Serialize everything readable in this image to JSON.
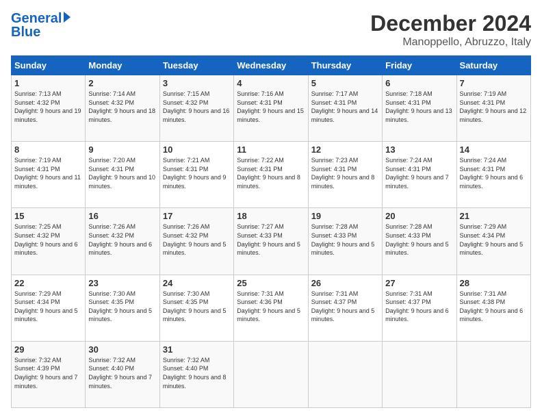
{
  "header": {
    "logo_line1": "General",
    "logo_line2": "Blue",
    "title": "December 2024",
    "subtitle": "Manoppello, Abruzzo, Italy"
  },
  "weekdays": [
    "Sunday",
    "Monday",
    "Tuesday",
    "Wednesday",
    "Thursday",
    "Friday",
    "Saturday"
  ],
  "weeks": [
    [
      {
        "day": "1",
        "sunrise": "7:13 AM",
        "sunset": "4:32 PM",
        "daylight": "9 hours and 19 minutes."
      },
      {
        "day": "2",
        "sunrise": "7:14 AM",
        "sunset": "4:32 PM",
        "daylight": "9 hours and 18 minutes."
      },
      {
        "day": "3",
        "sunrise": "7:15 AM",
        "sunset": "4:32 PM",
        "daylight": "9 hours and 16 minutes."
      },
      {
        "day": "4",
        "sunrise": "7:16 AM",
        "sunset": "4:31 PM",
        "daylight": "9 hours and 15 minutes."
      },
      {
        "day": "5",
        "sunrise": "7:17 AM",
        "sunset": "4:31 PM",
        "daylight": "9 hours and 14 minutes."
      },
      {
        "day": "6",
        "sunrise": "7:18 AM",
        "sunset": "4:31 PM",
        "daylight": "9 hours and 13 minutes."
      },
      {
        "day": "7",
        "sunrise": "7:19 AM",
        "sunset": "4:31 PM",
        "daylight": "9 hours and 12 minutes."
      }
    ],
    [
      {
        "day": "8",
        "sunrise": "7:19 AM",
        "sunset": "4:31 PM",
        "daylight": "9 hours and 11 minutes."
      },
      {
        "day": "9",
        "sunrise": "7:20 AM",
        "sunset": "4:31 PM",
        "daylight": "9 hours and 10 minutes."
      },
      {
        "day": "10",
        "sunrise": "7:21 AM",
        "sunset": "4:31 PM",
        "daylight": "9 hours and 9 minutes."
      },
      {
        "day": "11",
        "sunrise": "7:22 AM",
        "sunset": "4:31 PM",
        "daylight": "9 hours and 8 minutes."
      },
      {
        "day": "12",
        "sunrise": "7:23 AM",
        "sunset": "4:31 PM",
        "daylight": "9 hours and 8 minutes."
      },
      {
        "day": "13",
        "sunrise": "7:24 AM",
        "sunset": "4:31 PM",
        "daylight": "9 hours and 7 minutes."
      },
      {
        "day": "14",
        "sunrise": "7:24 AM",
        "sunset": "4:31 PM",
        "daylight": "9 hours and 6 minutes."
      }
    ],
    [
      {
        "day": "15",
        "sunrise": "7:25 AM",
        "sunset": "4:32 PM",
        "daylight": "9 hours and 6 minutes."
      },
      {
        "day": "16",
        "sunrise": "7:26 AM",
        "sunset": "4:32 PM",
        "daylight": "9 hours and 6 minutes."
      },
      {
        "day": "17",
        "sunrise": "7:26 AM",
        "sunset": "4:32 PM",
        "daylight": "9 hours and 5 minutes."
      },
      {
        "day": "18",
        "sunrise": "7:27 AM",
        "sunset": "4:33 PM",
        "daylight": "9 hours and 5 minutes."
      },
      {
        "day": "19",
        "sunrise": "7:28 AM",
        "sunset": "4:33 PM",
        "daylight": "9 hours and 5 minutes."
      },
      {
        "day": "20",
        "sunrise": "7:28 AM",
        "sunset": "4:33 PM",
        "daylight": "9 hours and 5 minutes."
      },
      {
        "day": "21",
        "sunrise": "7:29 AM",
        "sunset": "4:34 PM",
        "daylight": "9 hours and 5 minutes."
      }
    ],
    [
      {
        "day": "22",
        "sunrise": "7:29 AM",
        "sunset": "4:34 PM",
        "daylight": "9 hours and 5 minutes."
      },
      {
        "day": "23",
        "sunrise": "7:30 AM",
        "sunset": "4:35 PM",
        "daylight": "9 hours and 5 minutes."
      },
      {
        "day": "24",
        "sunrise": "7:30 AM",
        "sunset": "4:35 PM",
        "daylight": "9 hours and 5 minutes."
      },
      {
        "day": "25",
        "sunrise": "7:31 AM",
        "sunset": "4:36 PM",
        "daylight": "9 hours and 5 minutes."
      },
      {
        "day": "26",
        "sunrise": "7:31 AM",
        "sunset": "4:37 PM",
        "daylight": "9 hours and 5 minutes."
      },
      {
        "day": "27",
        "sunrise": "7:31 AM",
        "sunset": "4:37 PM",
        "daylight": "9 hours and 6 minutes."
      },
      {
        "day": "28",
        "sunrise": "7:31 AM",
        "sunset": "4:38 PM",
        "daylight": "9 hours and 6 minutes."
      }
    ],
    [
      {
        "day": "29",
        "sunrise": "7:32 AM",
        "sunset": "4:39 PM",
        "daylight": "9 hours and 7 minutes."
      },
      {
        "day": "30",
        "sunrise": "7:32 AM",
        "sunset": "4:40 PM",
        "daylight": "9 hours and 7 minutes."
      },
      {
        "day": "31",
        "sunrise": "7:32 AM",
        "sunset": "4:40 PM",
        "daylight": "9 hours and 8 minutes."
      },
      null,
      null,
      null,
      null
    ]
  ]
}
